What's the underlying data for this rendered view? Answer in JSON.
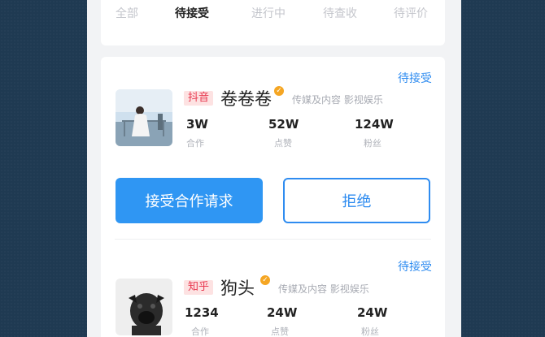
{
  "tabs": [
    {
      "label": "全部",
      "active": false
    },
    {
      "label": "待接受",
      "active": true
    },
    {
      "label": "进行中",
      "active": false
    },
    {
      "label": "待查收",
      "active": false
    },
    {
      "label": "待评价",
      "active": false
    }
  ],
  "items": [
    {
      "status": "待接受",
      "platform": "抖音",
      "name": "卷卷卷",
      "categories": "传媒及内容 影视娱乐",
      "stats": [
        {
          "value": "3W",
          "label": "合作"
        },
        {
          "value": "52W",
          "label": "点赞"
        },
        {
          "value": "124W",
          "label": "粉丝"
        }
      ],
      "accept_label": "接受合作请求",
      "reject_label": "拒绝"
    },
    {
      "status": "待接受",
      "platform": "知乎",
      "name": "狗头",
      "categories": "传媒及内容 影视娱乐",
      "stats": [
        {
          "value": "1234",
          "label": "合作"
        },
        {
          "value": "24W",
          "label": "点赞"
        },
        {
          "value": "24W",
          "label": "粉丝"
        }
      ]
    }
  ],
  "colors": {
    "accent": "#2f96f3",
    "tag_bg": "#fde2e2",
    "tag_text": "#e8384f",
    "verified": "#f5a623"
  },
  "icons": {
    "verified": "verified-badge-icon"
  }
}
